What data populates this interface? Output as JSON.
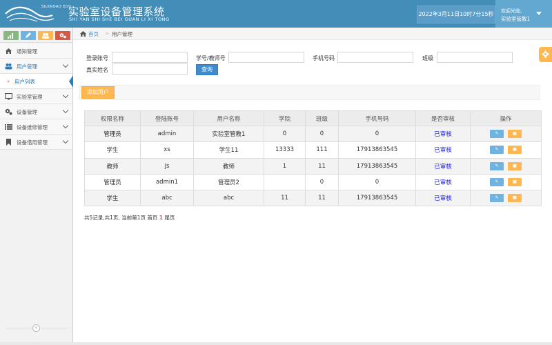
{
  "header": {
    "logo_small": "SILKROAD EDU",
    "title": "实验室设备管理系统",
    "subtitle": "SHI YAN SHI SHE BEI GUAN LI XI TONG",
    "datetime": "2022年3月11日10时7分15秒",
    "welcome": "欢迎光临,",
    "user": "实验室管教1"
  },
  "colors": {
    "header": "#438eb9",
    "accent": "#2b7dbc",
    "warning": "#ffb752",
    "info": "#6fb3e0",
    "status": "#1a1ae6"
  },
  "shortcuts": [
    {
      "icon": "signal-icon",
      "color": "#87b87f"
    },
    {
      "icon": "pencil-icon",
      "color": "#6fb3e0"
    },
    {
      "icon": "users-icon",
      "color": "#ffb752"
    },
    {
      "icon": "cogs-icon",
      "color": "#d15b47"
    }
  ],
  "sidebar": {
    "items": [
      {
        "label": "通知管理",
        "icon": "home-icon"
      },
      {
        "label": "用户管理",
        "icon": "users-icon"
      },
      {
        "label": "实验室管理",
        "icon": "desktop-icon"
      },
      {
        "label": "设备管理",
        "icon": "cogs-icon"
      },
      {
        "label": "设备维修管理",
        "icon": "list-icon"
      },
      {
        "label": "设备借用管理",
        "icon": "bookmark-icon"
      }
    ],
    "active_sub": "用户列表"
  },
  "breadcrumb": {
    "home": "首页",
    "separator": ">",
    "current": "用户管理"
  },
  "search": {
    "login_label": "登录账号",
    "sid_label": "学号/教师号",
    "phone_label": "手机号码",
    "class_label": "班级",
    "name_label": "真实姓名",
    "query_button": "查询"
  },
  "add_button": "添加用户",
  "table": {
    "headers": [
      "权限名称",
      "登陆账号",
      "用户名称",
      "学院",
      "班级",
      "手机号码",
      "是否审核",
      "操作"
    ],
    "rows": [
      [
        "管理员",
        "admin",
        "实验室管教1",
        "0",
        "0",
        "0",
        "已审核"
      ],
      [
        "学生",
        "xs",
        "学生11",
        "13333",
        "111",
        "17913863545",
        "已审核"
      ],
      [
        "教师",
        "js",
        "教师",
        "1",
        "11",
        "17913863545",
        "已审核"
      ],
      [
        "管理员",
        "admin1",
        "管理员2",
        "",
        "0",
        "0",
        "已审核"
      ],
      [
        "学生",
        "abc",
        "abc",
        "11",
        "11",
        "17913863545",
        "已审核"
      ]
    ],
    "edit_icon": "edit-icon",
    "delete_icon": "trash-icon"
  },
  "pager": {
    "summary": "共5记录,共1页, 当前第1页 首页",
    "current": "1",
    "last": "尾页"
  }
}
